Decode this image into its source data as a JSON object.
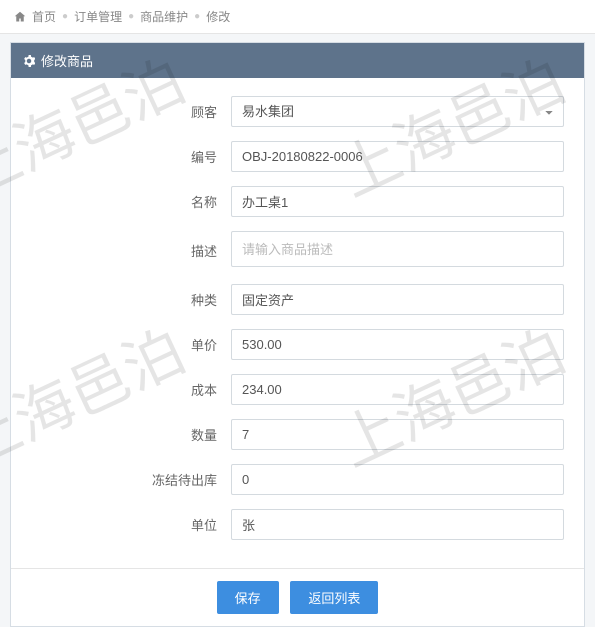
{
  "breadcrumb": {
    "home": "首页",
    "items": [
      "订单管理",
      "商品维护",
      "修改"
    ]
  },
  "panel": {
    "title": "修改商品"
  },
  "form": {
    "customer": {
      "label": "顾客",
      "value": "易水集团"
    },
    "code": {
      "label": "编号",
      "value": "OBJ-20180822-0006"
    },
    "name": {
      "label": "名称",
      "value": "办工桌1"
    },
    "desc": {
      "label": "描述",
      "placeholder": "请输入商品描述"
    },
    "category": {
      "label": "种类",
      "value": "固定资产"
    },
    "price": {
      "label": "单价",
      "value": "530.00"
    },
    "cost": {
      "label": "成本",
      "value": "234.00"
    },
    "qty": {
      "label": "数量",
      "value": "7"
    },
    "frozen": {
      "label": "冻结待出库",
      "value": "0"
    },
    "unit": {
      "label": "单位",
      "value": "张"
    }
  },
  "actions": {
    "save": "保存",
    "back": "返回列表"
  },
  "watermark": "上海邑泊"
}
